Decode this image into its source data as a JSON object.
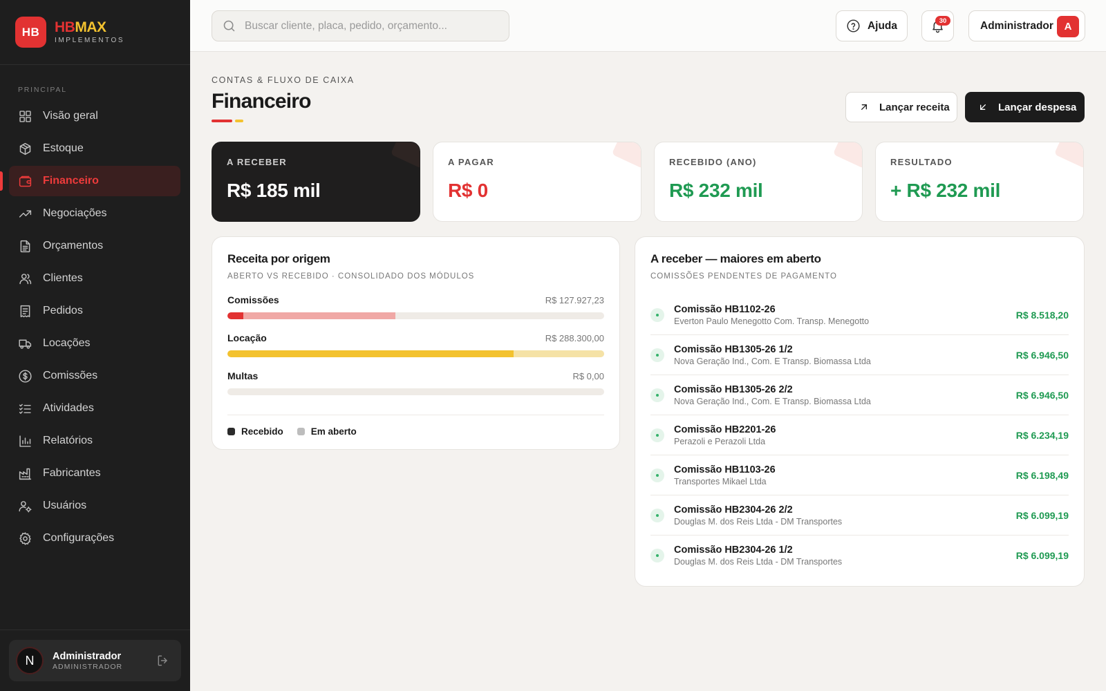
{
  "brand": {
    "logo": "HB",
    "name_a": "HB",
    "name_b": "MAX",
    "sub": "IMPLEMENTOS"
  },
  "sidebar": {
    "section": "PRINCIPAL",
    "items": [
      {
        "label": "Visão geral",
        "icon": "grid-icon"
      },
      {
        "label": "Estoque",
        "icon": "box-icon"
      },
      {
        "label": "Financeiro",
        "icon": "wallet-icon",
        "active": true
      },
      {
        "label": "Negociações",
        "icon": "trending-up-icon"
      },
      {
        "label": "Orçamentos",
        "icon": "file-text-icon"
      },
      {
        "label": "Clientes",
        "icon": "users-icon"
      },
      {
        "label": "Pedidos",
        "icon": "receipt-icon"
      },
      {
        "label": "Locações",
        "icon": "truck-icon"
      },
      {
        "label": "Comissões",
        "icon": "dollar-circle-icon"
      },
      {
        "label": "Atividades",
        "icon": "list-checks-icon"
      },
      {
        "label": "Relatórios",
        "icon": "bar-chart-icon"
      },
      {
        "label": "Fabricantes",
        "icon": "factory-icon"
      },
      {
        "label": "Usuários",
        "icon": "user-cog-icon"
      },
      {
        "label": "Configurações",
        "icon": "gear-icon"
      }
    ],
    "user": {
      "initial": "N",
      "name": "Administrador",
      "role": "ADMINISTRADOR"
    }
  },
  "topbar": {
    "search_placeholder": "Buscar cliente, placa, pedido, orçamento...",
    "help_label": "Ajuda",
    "notifications_count": "30",
    "admin_label": "Administrador",
    "admin_initial": "A"
  },
  "page": {
    "eyebrow": "CONTAS & FLUXO DE CAIXA",
    "title": "Financeiro",
    "btn_receita": "Lançar receita",
    "btn_despesa": "Lançar despesa"
  },
  "kpis": [
    {
      "label": "A RECEBER",
      "value": "R$ 185 mil",
      "color": "#ffffff"
    },
    {
      "label": "A PAGAR",
      "value": "R$ 0",
      "color": "#e23232"
    },
    {
      "label": "RECEBIDO (ANO)",
      "value": "R$ 232 mil",
      "color": "#1f9a52"
    },
    {
      "label": "RESULTADO",
      "value": "+ R$ 232 mil",
      "color": "#1f9a52"
    }
  ],
  "origem": {
    "title": "Receita por origem",
    "subtitle": "ABERTO VS RECEBIDO · CONSOLIDADO DOS MÓDULOS",
    "rows": [
      {
        "label": "Comissões",
        "amount": "R$ 127.927,23",
        "received_pct": 4.3,
        "total_pct": 44.5,
        "recv_color": "#e23232",
        "open_color": "#f0a8a5"
      },
      {
        "label": "Locação",
        "amount": "R$ 288.300,00",
        "received_pct": 76,
        "total_pct": 100,
        "recv_color": "#f3c22f",
        "open_color": "#f5e2a6"
      },
      {
        "label": "Multas",
        "amount": "R$ 0,00",
        "received_pct": 0,
        "total_pct": 0,
        "recv_color": "#999999",
        "open_color": "#dddddd"
      }
    ],
    "legend": [
      {
        "label": "Recebido",
        "color": "#2b2b2b"
      },
      {
        "label": "Em aberto",
        "color": "#bdbdbd"
      }
    ]
  },
  "receber": {
    "title": "A receber — maiores em aberto",
    "subtitle": "COMISSÕES PENDENTES DE PAGAMENTO",
    "items": [
      {
        "name": "Comissão HB1102-26",
        "client": "Everton Paulo Menegotto Com. Transp. Menegotto",
        "value": "R$ 8.518,20"
      },
      {
        "name": "Comissão HB1305-26 1/2",
        "client": "Nova Geração Ind., Com. E Transp. Biomassa Ltda",
        "value": "R$ 6.946,50"
      },
      {
        "name": "Comissão HB1305-26 2/2",
        "client": "Nova Geração Ind., Com. E Transp. Biomassa Ltda",
        "value": "R$ 6.946,50"
      },
      {
        "name": "Comissão HB2201-26",
        "client": "Perazoli e Perazoli Ltda",
        "value": "R$ 6.234,19"
      },
      {
        "name": "Comissão HB1103-26",
        "client": "Transportes Mikael Ltda",
        "value": "R$ 6.198,49"
      },
      {
        "name": "Comissão HB2304-26 2/2",
        "client": "Douglas M. dos Reis Ltda - DM Transportes",
        "value": "R$ 6.099,19"
      },
      {
        "name": "Comissão HB2304-26 1/2",
        "client": "Douglas M. dos Reis Ltda - DM Transportes",
        "value": "R$ 6.099,19"
      }
    ]
  }
}
